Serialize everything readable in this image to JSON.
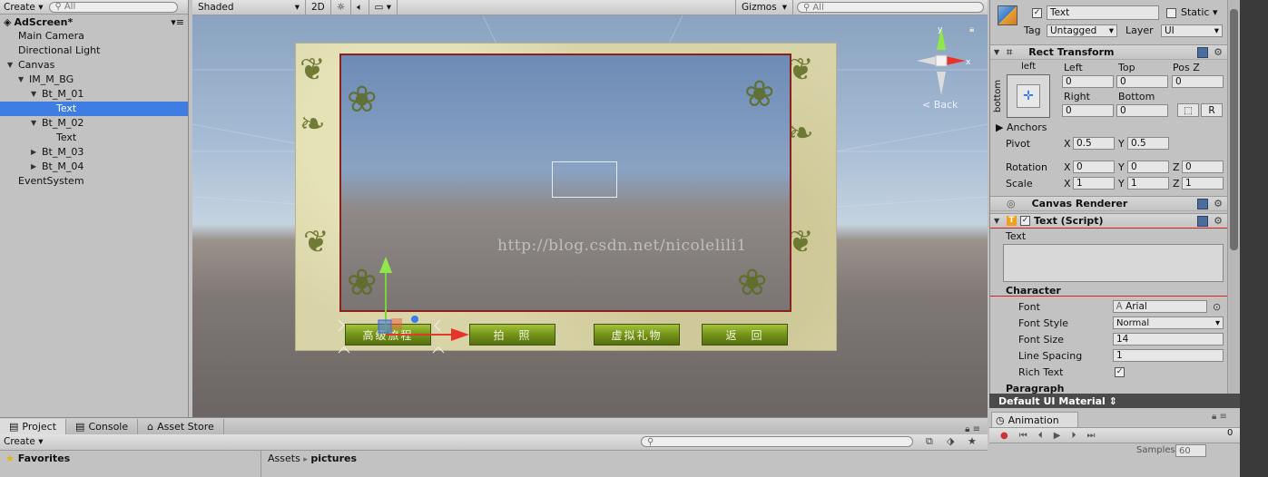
{
  "hierarchy": {
    "create_label": "Create",
    "search_placeholder": "All",
    "scene_name": "AdScreen*",
    "items": [
      {
        "label": "Main Camera",
        "arrow": ""
      },
      {
        "label": "Directional Light",
        "arrow": ""
      },
      {
        "label": "Canvas",
        "arrow": "▼"
      },
      {
        "label": "IM_M_BG",
        "arrow": "▼"
      },
      {
        "label": "Bt_M_01",
        "arrow": "▼"
      },
      {
        "label": "Text",
        "arrow": ""
      },
      {
        "label": "Bt_M_02",
        "arrow": "▼"
      },
      {
        "label": "Text",
        "arrow": ""
      },
      {
        "label": "Bt_M_03",
        "arrow": "▶"
      },
      {
        "label": "Bt_M_04",
        "arrow": "▶"
      },
      {
        "label": "EventSystem",
        "arrow": ""
      }
    ]
  },
  "scene_toolbar": {
    "shading": "Shaded",
    "mode_2d": "2D",
    "gizmos": "Gizmos",
    "search_placeholder": "All"
  },
  "scene": {
    "buttons": [
      "高级旅程",
      "拍　照",
      "虚拟礼物",
      "返　回"
    ],
    "watermark": "http://blog.csdn.net/nicolelili1",
    "gizmo_back": "Back",
    "gizmo_y": "y",
    "gizmo_x": "x"
  },
  "inspector": {
    "name": "Text",
    "static_label": "Static",
    "tag_label": "Tag",
    "tag_value": "Untagged",
    "layer_label": "Layer",
    "layer_value": "UI",
    "rect_transform": {
      "title": "Rect Transform",
      "anchor_h": "left",
      "anchor_v": "bottom",
      "left_label": "Left",
      "left_value": "0",
      "top_label": "Top",
      "top_value": "0",
      "posz_label": "Pos Z",
      "posz_value": "0",
      "right_label": "Right",
      "right_value": "0",
      "bottom_label": "Bottom",
      "bottom_value": "0",
      "r_button": "R",
      "anchors_label": "Anchors",
      "pivot_label": "Pivot",
      "pivot_x": "0.5",
      "pivot_y": "0.5",
      "rotation_label": "Rotation",
      "rot_x": "0",
      "rot_y": "0",
      "rot_z": "0",
      "scale_label": "Scale",
      "scale_x": "1",
      "scale_y": "1",
      "scale_z": "1",
      "x": "X",
      "y": "Y",
      "z": "Z"
    },
    "canvas_renderer": "Canvas Renderer",
    "text_script": {
      "title": "Text (Script)",
      "text_label": "Text",
      "text_value": "",
      "character_label": "Character",
      "font_label": "Font",
      "font_value": "Arial",
      "font_style_label": "Font Style",
      "font_style_value": "Normal",
      "font_size_label": "Font Size",
      "font_size_value": "14",
      "line_spacing_label": "Line Spacing",
      "line_spacing_value": "1",
      "rich_text_label": "Rich Text",
      "paragraph_label": "Paragraph"
    },
    "material": "Default UI Material",
    "highlight_color": "#d42020"
  },
  "animation": {
    "tab": "Animation",
    "frame": "0",
    "samples_label": "Samples",
    "samples_value": "60"
  },
  "project": {
    "tabs": [
      "Project",
      "Console",
      "Asset Store"
    ],
    "create_label": "Create",
    "favorites": "Favorites",
    "breadcrumb": [
      "Assets",
      "pictures"
    ]
  }
}
